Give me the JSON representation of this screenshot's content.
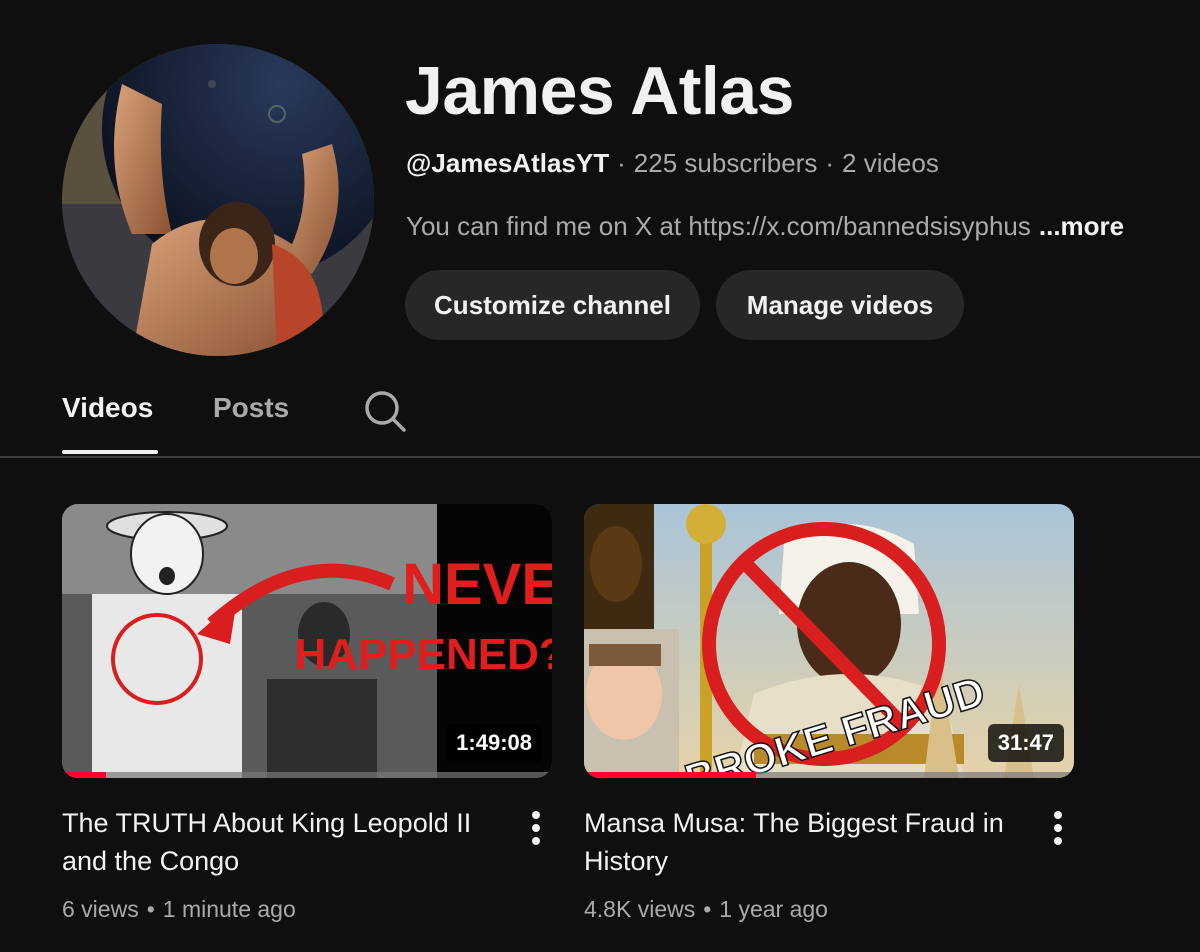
{
  "channel": {
    "name": "James Atlas",
    "handle": "@JamesAtlasYT",
    "subscribers": "225 subscribers",
    "videos_count": "2 videos",
    "description": "You can find me on X at https://x.com/bannedsisyphus",
    "more_label": "...more",
    "avatar_icon": "atlas-painting-avatar"
  },
  "buttons": {
    "customize_label": "Customize channel",
    "manage_label": "Manage videos"
  },
  "tabs": {
    "items": [
      {
        "label": "Videos",
        "active": true
      },
      {
        "label": "Posts",
        "active": false
      }
    ],
    "search_icon": "search-icon"
  },
  "videos": [
    {
      "title": "The TRUTH About King Leopold II and the Congo",
      "duration": "1:49:08",
      "views": "6 views",
      "age": "1 minute ago",
      "thumb_text_1": "NEVER",
      "thumb_text_2": "HAPPENED???",
      "watched_fraction": 0.09
    },
    {
      "title": "Mansa Musa: The Biggest Fraud in History",
      "duration": "31:47",
      "views": "4.8K views",
      "age": "1 year ago",
      "thumb_text_1": "BROKE FRAUD",
      "watched_fraction": 0.35
    }
  ],
  "colors": {
    "background": "#0f0f0f",
    "button_bg": "#272727",
    "muted_text": "#aaaaaa",
    "progress_red": "#ff0033"
  }
}
